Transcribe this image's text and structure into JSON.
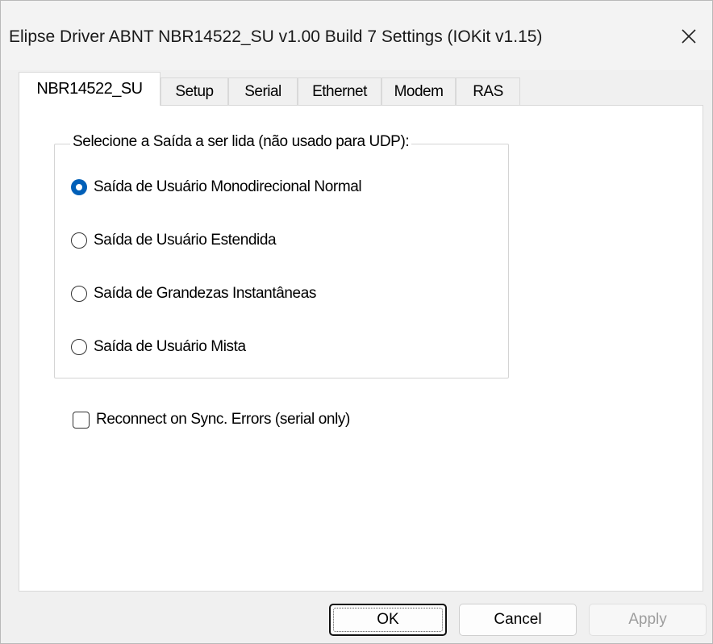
{
  "window": {
    "title": "Elipse Driver ABNT NBR14522_SU v1.00 Build 7 Settings (IOKit v1.15)",
    "close_icon": "close-icon"
  },
  "tabs": [
    {
      "label": "NBR14522_SU",
      "active": true
    },
    {
      "label": "Setup",
      "active": false
    },
    {
      "label": "Serial",
      "active": false
    },
    {
      "label": "Ethernet",
      "active": false
    },
    {
      "label": "Modem",
      "active": false
    },
    {
      "label": "RAS",
      "active": false
    }
  ],
  "output_group": {
    "legend": "Selecione a Saída a ser lida (não usado para UDP):",
    "options": [
      {
        "label": "Saída de Usuário Monodirecional Normal",
        "selected": true
      },
      {
        "label": "Saída de Usuário Estendida",
        "selected": false
      },
      {
        "label": "Saída de Grandezas Instantâneas",
        "selected": false
      },
      {
        "label": "Saída de Usuário Mista",
        "selected": false
      }
    ]
  },
  "reconnect": {
    "label": "Reconnect on Sync. Errors (serial only)",
    "checked": false
  },
  "buttons": {
    "ok": "OK",
    "cancel": "Cancel",
    "apply": "Apply"
  },
  "colors": {
    "accent": "#005fb8",
    "disabled_text": "#9d9d9d"
  }
}
